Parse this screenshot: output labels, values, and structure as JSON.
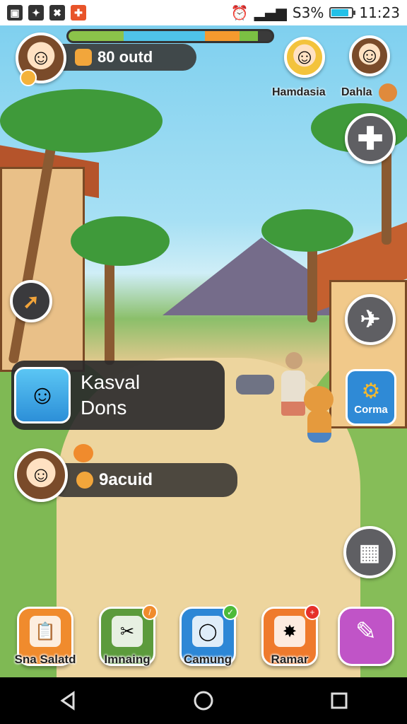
{
  "status_bar": {
    "signal_text": "S3%",
    "time": "11:23",
    "battery_level": 0.85,
    "left_icons": [
      "image-icon",
      "settings-icon",
      "game-icon",
      "ad-icon"
    ]
  },
  "hud": {
    "health_bar": [
      {
        "color": "#8bc34a",
        "fraction": 0.27
      },
      {
        "color": "#4fc3e8",
        "fraction": 0.4
      },
      {
        "color": "#f59a2e",
        "fraction": 0.17
      },
      {
        "color": "#7bc043",
        "fraction": 0.09
      },
      {
        "color": "#3a3a3a",
        "fraction": 0.07
      }
    ],
    "coins_text": "80 outd",
    "player_avatar_icon": "girl-avatar-icon"
  },
  "friends": [
    {
      "name": "Hamdasia",
      "icon": "blonde-girl-avatar-icon"
    },
    {
      "name": "Dahla",
      "icon": "fairy-girl-avatar-icon"
    }
  ],
  "quest_card": {
    "line1": "Kasval",
    "line2": "Dons",
    "icon": "explorer-girl-icon"
  },
  "secondary_pill": {
    "text": "9acuid",
    "icon": "coin-icon"
  },
  "side_buttons": {
    "corma_label": "Corma"
  },
  "actions": [
    {
      "label": "Sna Salatd",
      "color": "#f08b2d",
      "icon": "clipboard-icon",
      "badge": ""
    },
    {
      "label": "Imnaing",
      "color": "#5c9b3c",
      "icon": "crossed-tools-icon",
      "badge": ""
    },
    {
      "label": "Camung",
      "color": "#2d87d6",
      "icon": "chat-bubble-icon",
      "badge": ""
    },
    {
      "label": "Ramar",
      "color": "#ef7a2c",
      "icon": "sun-burst-icon",
      "badge": ""
    },
    {
      "label": "",
      "color": "#c054c7",
      "icon": "pencil-icon",
      "badge": ""
    }
  ]
}
